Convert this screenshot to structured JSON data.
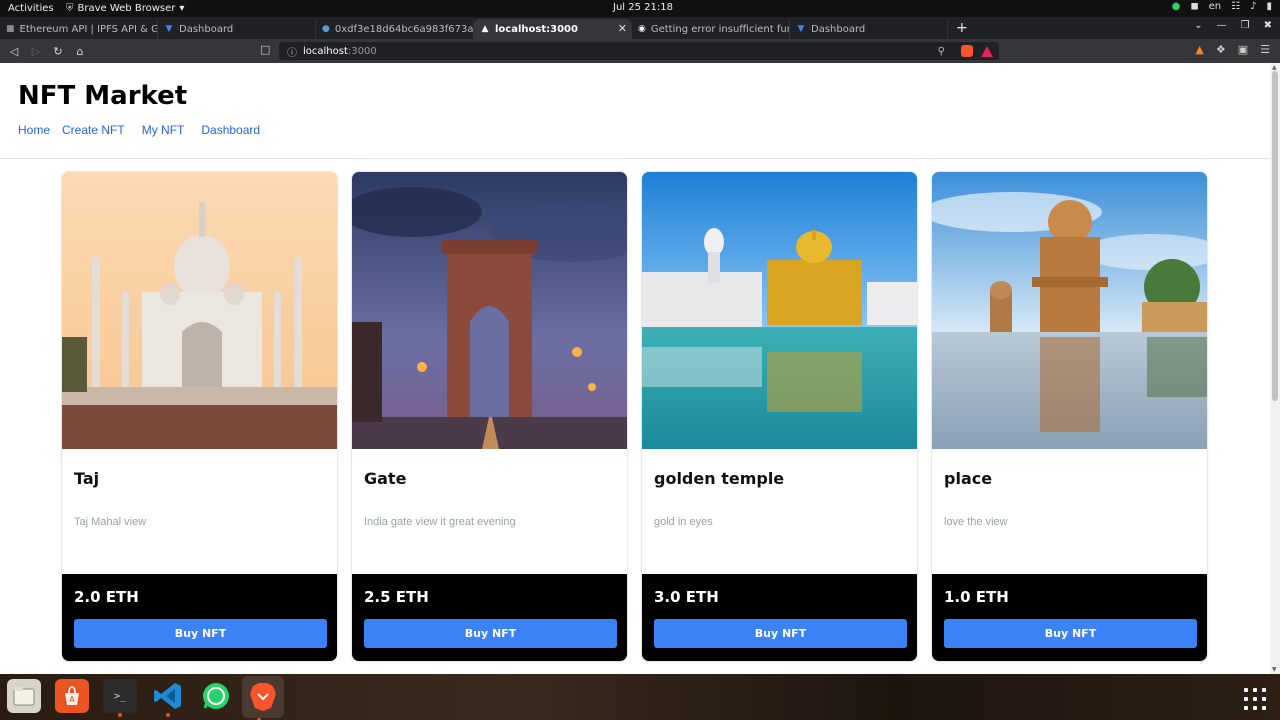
{
  "system_bar": {
    "activities": "Activities",
    "app_name": "Brave Web Browser",
    "clock": "Jul 25  21:18",
    "lang": "en"
  },
  "tabs": [
    {
      "label": "Ethereum API | IPFS API & Gat",
      "active": false
    },
    {
      "label": "Dashboard",
      "active": false
    },
    {
      "label": "0xdf3e18d64bc6a983f673ab3",
      "active": false
    },
    {
      "label": "localhost:3000",
      "active": true
    },
    {
      "label": "Getting error insufficient fun",
      "active": false
    },
    {
      "label": "Dashboard",
      "active": false
    }
  ],
  "address_bar": {
    "host": "localhost",
    "port": ":3000"
  },
  "site": {
    "title": "NFT Market",
    "nav": [
      "Home",
      "Create NFT",
      "My NFT",
      "Dashboard"
    ]
  },
  "nfts": [
    {
      "name": "Taj",
      "description": "Taj Mahal view",
      "price": "2.0 ETH",
      "buy_label": "Buy NFT"
    },
    {
      "name": "Gate",
      "description": "India gate view it great evening",
      "price": "2.5 ETH",
      "buy_label": "Buy NFT"
    },
    {
      "name": "golden temple",
      "description": "gold in eyes",
      "price": "3.0 ETH",
      "buy_label": "Buy NFT"
    },
    {
      "name": "place",
      "description": "love the view",
      "price": "1.0 ETH",
      "buy_label": "Buy NFT"
    }
  ],
  "colors": {
    "link": "#2563eb",
    "buy_button": "#3b82f6",
    "card_footer": "#000000"
  }
}
